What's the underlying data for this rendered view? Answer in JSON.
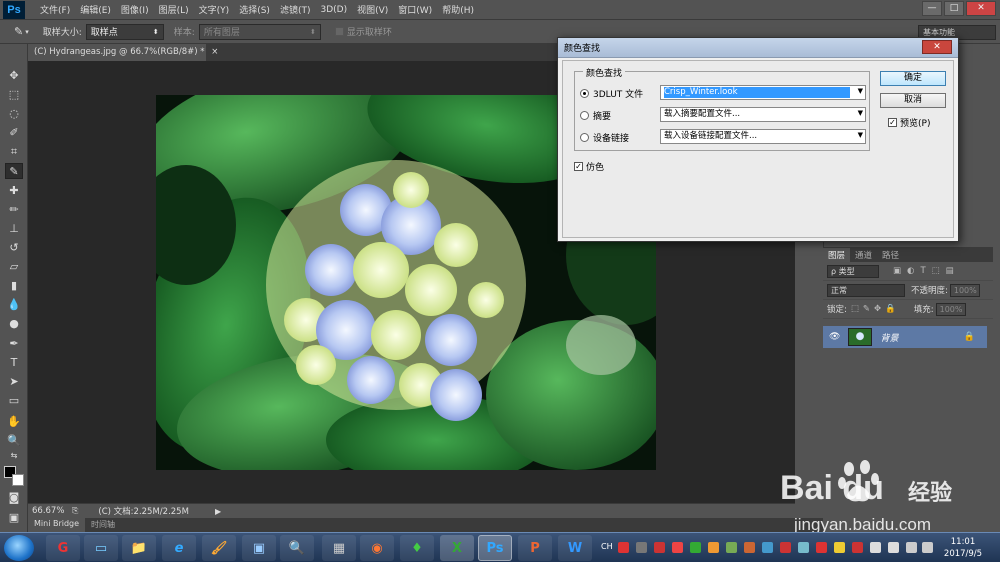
{
  "app": {
    "logo": "Ps",
    "menu": [
      "文件(F)",
      "编辑(E)",
      "图像(I)",
      "图层(L)",
      "文字(Y)",
      "选择(S)",
      "滤镜(T)",
      "3D(D)",
      "视图(V)",
      "窗口(W)",
      "帮助(H)"
    ],
    "window_controls": {
      "minimize": "—",
      "maximize": "□",
      "close": "✕"
    }
  },
  "options_bar": {
    "sample_size_label": "取样大小:",
    "sample_size_value": "取样点",
    "sample_label": "样本:",
    "sample_value": "所有图层",
    "show_ring_label": "显示取样环",
    "show_ring_checked": false,
    "workspace": "基本功能"
  },
  "document": {
    "tab_title": "(C) Hydrangeas.jpg @ 66.7%(RGB/8#) *",
    "tab_close": "×",
    "zoom": "66.67%",
    "doc_size": "(C) 文档:2.25M/2.25M"
  },
  "bottom_tabs": [
    "Mini Bridge",
    "时间轴"
  ],
  "layers_panel": {
    "tabs": [
      "图层",
      "通道",
      "路径"
    ],
    "filter_label": "ρ 类型",
    "blend_mode": "正常",
    "opacity_label": "不透明度:",
    "opacity_value": "100%",
    "lock_label": "锁定:",
    "fill_label": "填充:",
    "fill_value": "100%",
    "layer_name": "背景"
  },
  "dialog": {
    "title": "颜色查找",
    "close": "✕",
    "group_title": "颜色查找",
    "options": [
      {
        "label": "3DLUT 文件",
        "value": "Crisp_Winter.look",
        "selected": true
      },
      {
        "label": "摘要",
        "value": "载入摘要配置文件...",
        "selected": false
      },
      {
        "label": "设备链接",
        "value": "载入设备链接配置文件...",
        "selected": false
      }
    ],
    "dither_label": "仿色",
    "dither_checked": true,
    "ok_label": "确定",
    "cancel_label": "取消",
    "preview_label": "预览(P)",
    "preview_checked": true
  },
  "taskbar": {
    "apps": [
      "G",
      "▭",
      "📁",
      "e",
      "🖌",
      "▣",
      "🔍",
      "▦",
      "◉",
      "♦",
      "X",
      "Ps",
      "P",
      "W"
    ],
    "ime": "CH",
    "time": "11:01",
    "date": "2017/9/5"
  },
  "watermark": {
    "brand": "Bai  du",
    "text": "经验",
    "url": "jingyan.baidu.com"
  },
  "colors": {
    "ui_bg": "#535353",
    "canvas_bg": "#282828",
    "selection": "#5d79a5",
    "dialog_bg": "#f0f0f0"
  }
}
